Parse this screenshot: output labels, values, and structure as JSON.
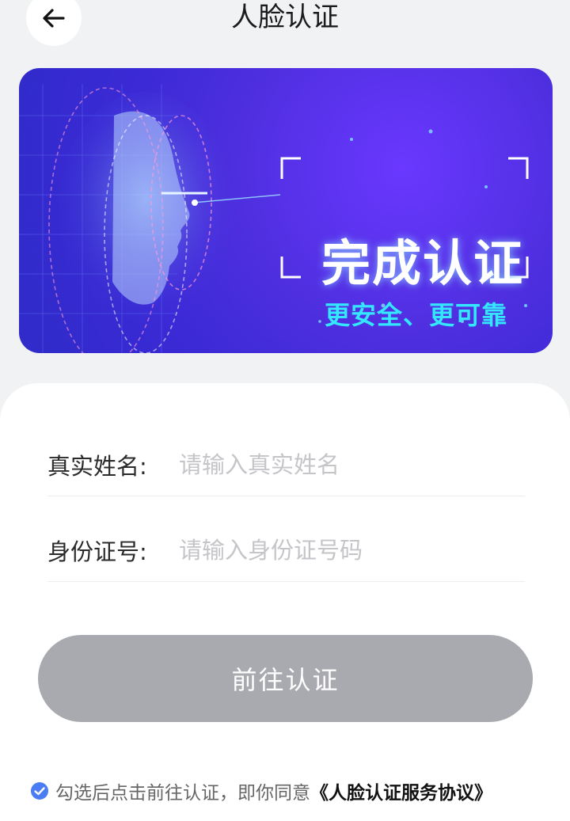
{
  "header": {
    "back_icon": "arrow-left-icon",
    "title": "人脸认证"
  },
  "banner": {
    "headline": "完成认证",
    "subline": "更安全、更可靠"
  },
  "form": {
    "name_label": "真实姓名:",
    "name_placeholder": "请输入真实姓名",
    "id_label": "身份证号:",
    "id_placeholder": "请输入身份证号码"
  },
  "submit": {
    "label": "前往认证"
  },
  "agreement": {
    "checked": true,
    "text": "勾选后点击前往认证，即你同意",
    "link": "《人脸认证服务协议》"
  },
  "colors": {
    "banner_blue": "#3b2ad6",
    "banner_violet": "#6a38ff",
    "accent_cyan": "#34e6ff",
    "button_disabled": "#a9aab0",
    "check_blue": "#4a7cf3"
  }
}
